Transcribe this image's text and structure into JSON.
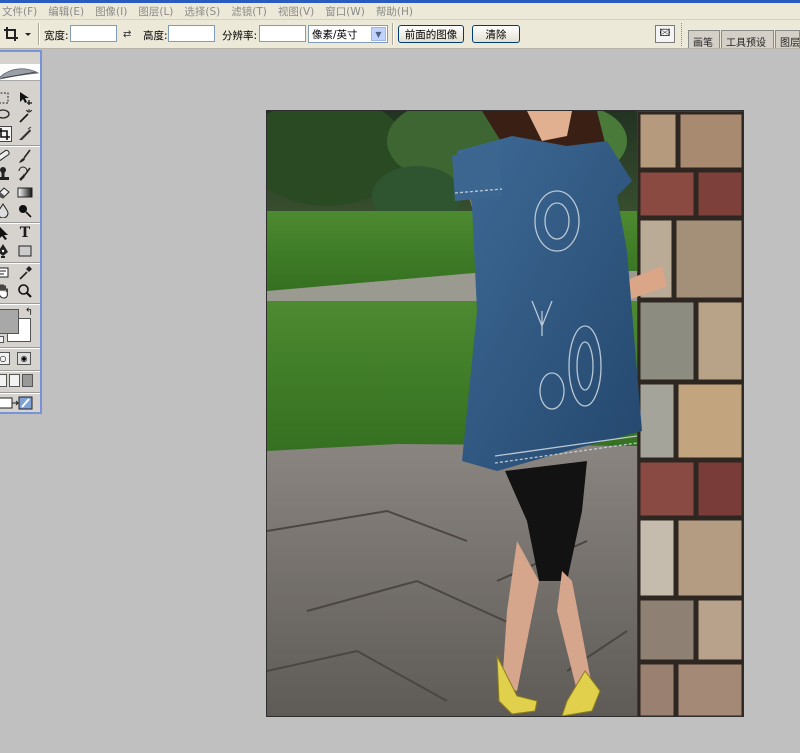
{
  "menubar": {
    "items": [
      "文件(F)",
      "编辑(E)",
      "图像(I)",
      "图层(L)",
      "选择(S)",
      "滤镜(T)",
      "视图(V)",
      "窗口(W)",
      "帮助(H)"
    ]
  },
  "options": {
    "width_label": "宽度:",
    "width_value": "",
    "height_label": "高度:",
    "height_value": "",
    "resolution_label": "分辨率:",
    "resolution_value": "",
    "unit_selected": "像素/英寸",
    "front_image_button": "前面的图像",
    "clear_button": "清除"
  },
  "palette_tabs": [
    "画笔",
    "工具预设",
    "图层复"
  ],
  "toolbox": {
    "tools": [
      "marquee-tool",
      "move-tool",
      "lasso-tool",
      "magic-wand-tool",
      "crop-tool",
      "slice-tool",
      "healing-brush-tool",
      "brush-tool",
      "clone-stamp-tool",
      "history-brush-tool",
      "eraser-tool",
      "gradient-tool",
      "blur-tool",
      "dodge-tool",
      "path-selection-tool",
      "type-tool",
      "pen-tool",
      "shape-tool",
      "notes-tool",
      "eyedropper-tool",
      "hand-tool",
      "zoom-tool"
    ],
    "type_glyph": "T",
    "foreground_color": "#a8a8a8",
    "background_color": "#ffffff"
  },
  "document": {
    "subject": "photo-woman-denim-dress-by-brick-pillar"
  }
}
